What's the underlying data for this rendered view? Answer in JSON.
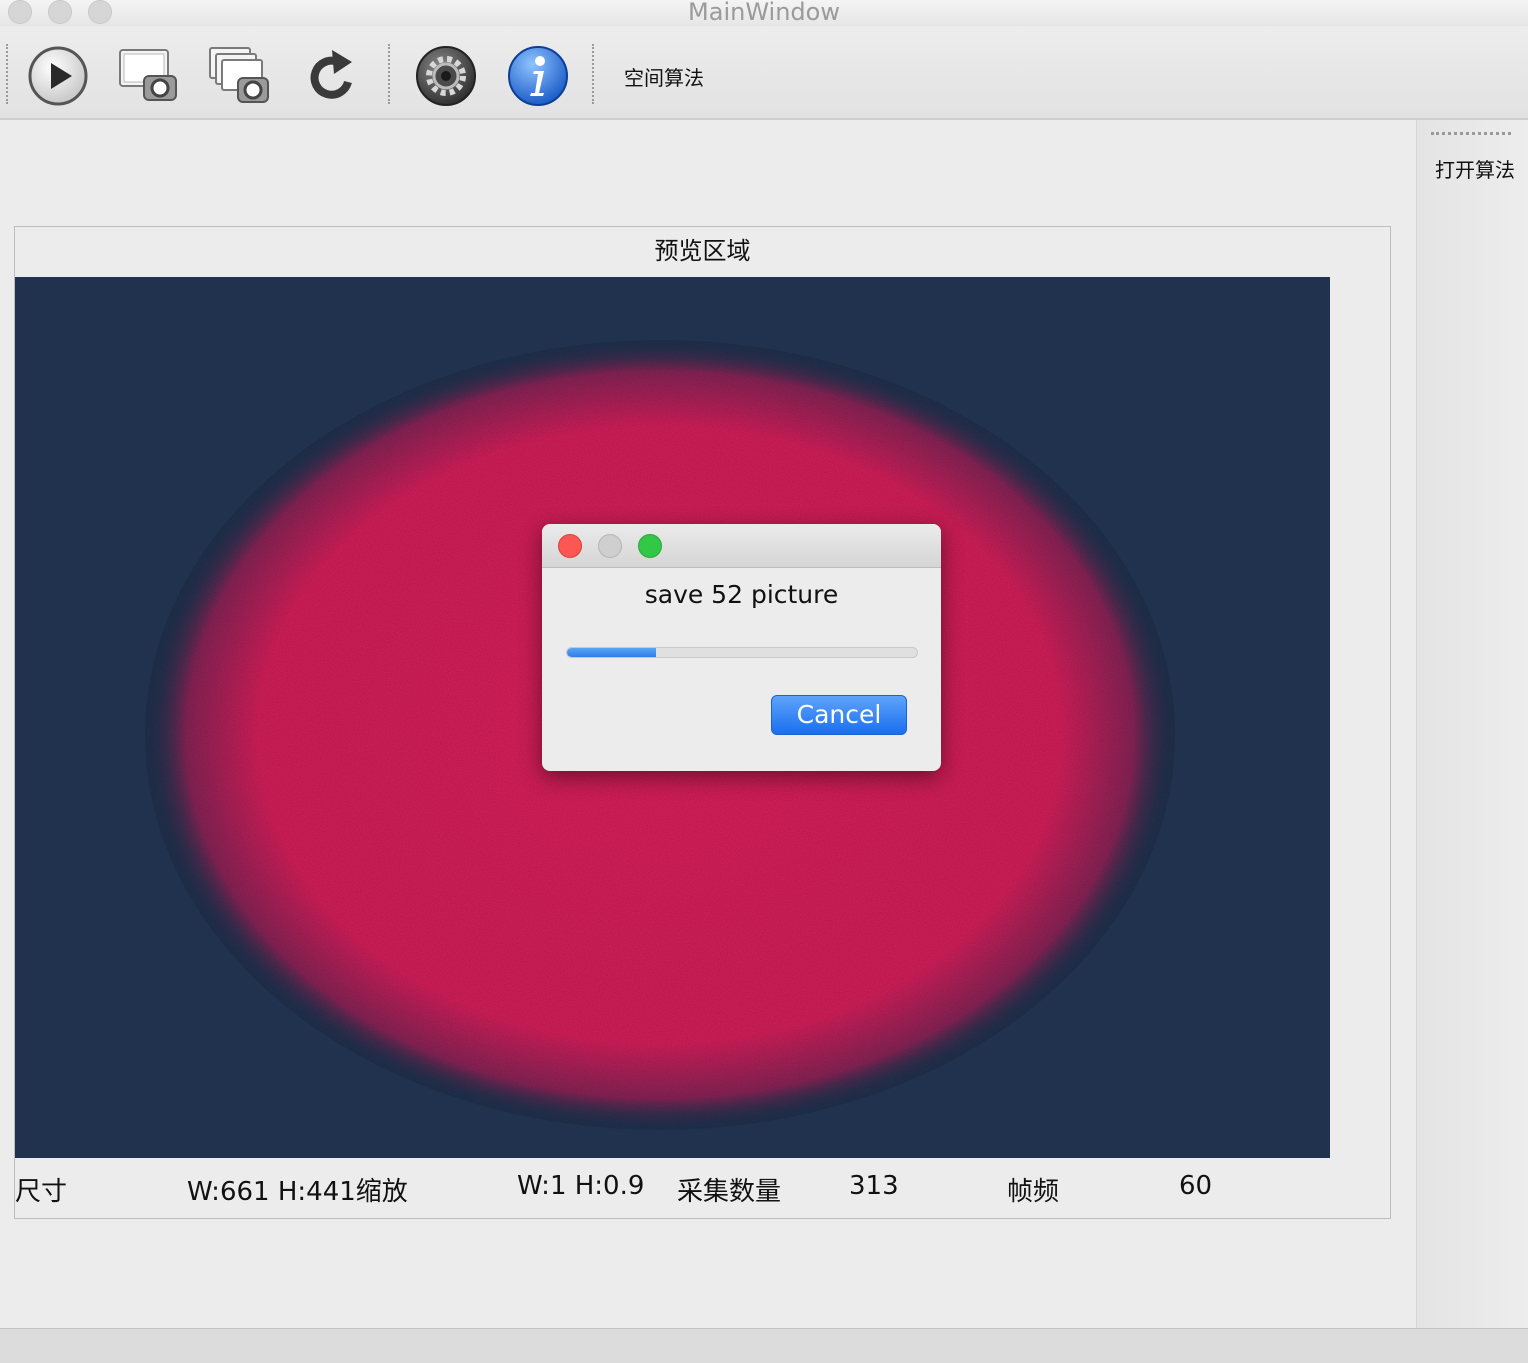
{
  "window": {
    "title": "MainWindow"
  },
  "toolbar": {
    "items": [
      {
        "icon": "play-icon"
      },
      {
        "icon": "capture-single-icon"
      },
      {
        "icon": "capture-multi-icon"
      },
      {
        "icon": "refresh-icon"
      },
      {
        "icon": "gear-icon"
      },
      {
        "icon": "info-icon"
      }
    ],
    "algo_label": "空间算法"
  },
  "dock": {
    "label": "打开算法"
  },
  "preview": {
    "title": "预览区域",
    "colors": {
      "background": "#21324f",
      "spot": "#e0205e"
    }
  },
  "status": {
    "size_label": "尺寸",
    "size_value": "W:661 H:441缩放",
    "scale_value": "W:1 H:0.9",
    "count_label": "采集数量",
    "count_value": "313",
    "fps_label": "帧频",
    "fps_value": "60"
  },
  "dialog": {
    "message": "save 52 picture",
    "progress": 0.255,
    "cancel_label": "Cancel"
  },
  "colors": {
    "accent": "#2f7fe8",
    "close": "#fc5753",
    "minimize": "#cfcfcf",
    "zoom": "#33c748"
  }
}
